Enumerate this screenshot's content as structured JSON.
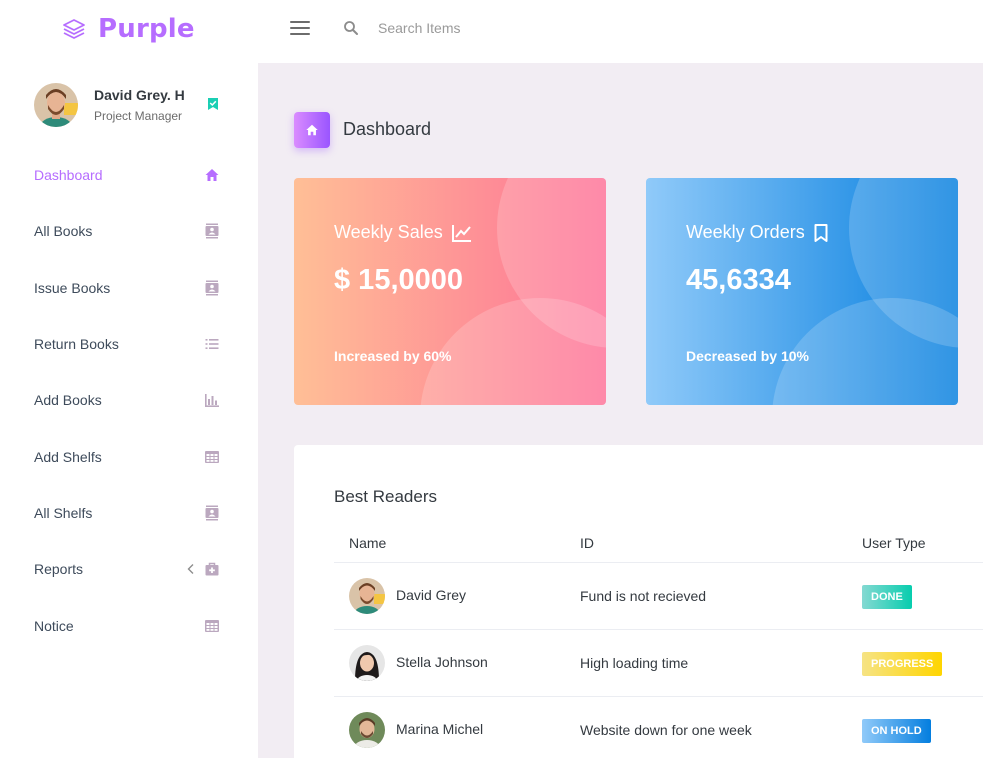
{
  "brand": {
    "name": "Purple",
    "icon": "layers-icon"
  },
  "search": {
    "placeholder": "Search Items"
  },
  "profile": {
    "name": "David Grey. H",
    "role": "Project Manager"
  },
  "sidebar": {
    "items": [
      {
        "label": "Dashboard",
        "icon": "home-icon",
        "active": true
      },
      {
        "label": "All Books",
        "icon": "contacts-icon"
      },
      {
        "label": "Issue Books",
        "icon": "contacts-icon"
      },
      {
        "label": "Return Books",
        "icon": "format-list-icon"
      },
      {
        "label": "Add Books",
        "icon": "bar-chart-icon"
      },
      {
        "label": "Add Shelfs",
        "icon": "table-grid-icon"
      },
      {
        "label": "All Shelfs",
        "icon": "contacts-icon"
      },
      {
        "label": "Reports",
        "icon": "medical-bag-icon",
        "has_submenu": true
      },
      {
        "label": "Notice",
        "icon": "table-grid-icon"
      }
    ]
  },
  "page": {
    "title": "Dashboard"
  },
  "cards": [
    {
      "title": "Weekly Sales",
      "value": "$ 15,0000",
      "note": "Increased by 60%",
      "icon": "chart-line-icon"
    },
    {
      "title": "Weekly Orders",
      "value": "45,6334",
      "note": "Decreased by 10%",
      "icon": "bookmark-outline-icon"
    }
  ],
  "readers": {
    "title": "Best Readers",
    "columns": [
      "Name",
      "ID",
      "User Type"
    ],
    "rows": [
      {
        "name": "David Grey",
        "id": "Fund is not recieved",
        "status": "DONE"
      },
      {
        "name": "Stella Johnson",
        "id": "High loading time",
        "status": "PROGRESS"
      },
      {
        "name": "Marina Michel",
        "id": "Website down for one week",
        "status": "ON HOLD"
      }
    ]
  },
  "colors": {
    "accent": "#b66dff",
    "sales_gradient": [
      "#ffbf96",
      "#fe7096"
    ],
    "orders_gradient": [
      "#90caf9",
      "#047edf"
    ],
    "done": "#07cdae",
    "progress": "#ffd500",
    "on_hold": "#047edf"
  }
}
